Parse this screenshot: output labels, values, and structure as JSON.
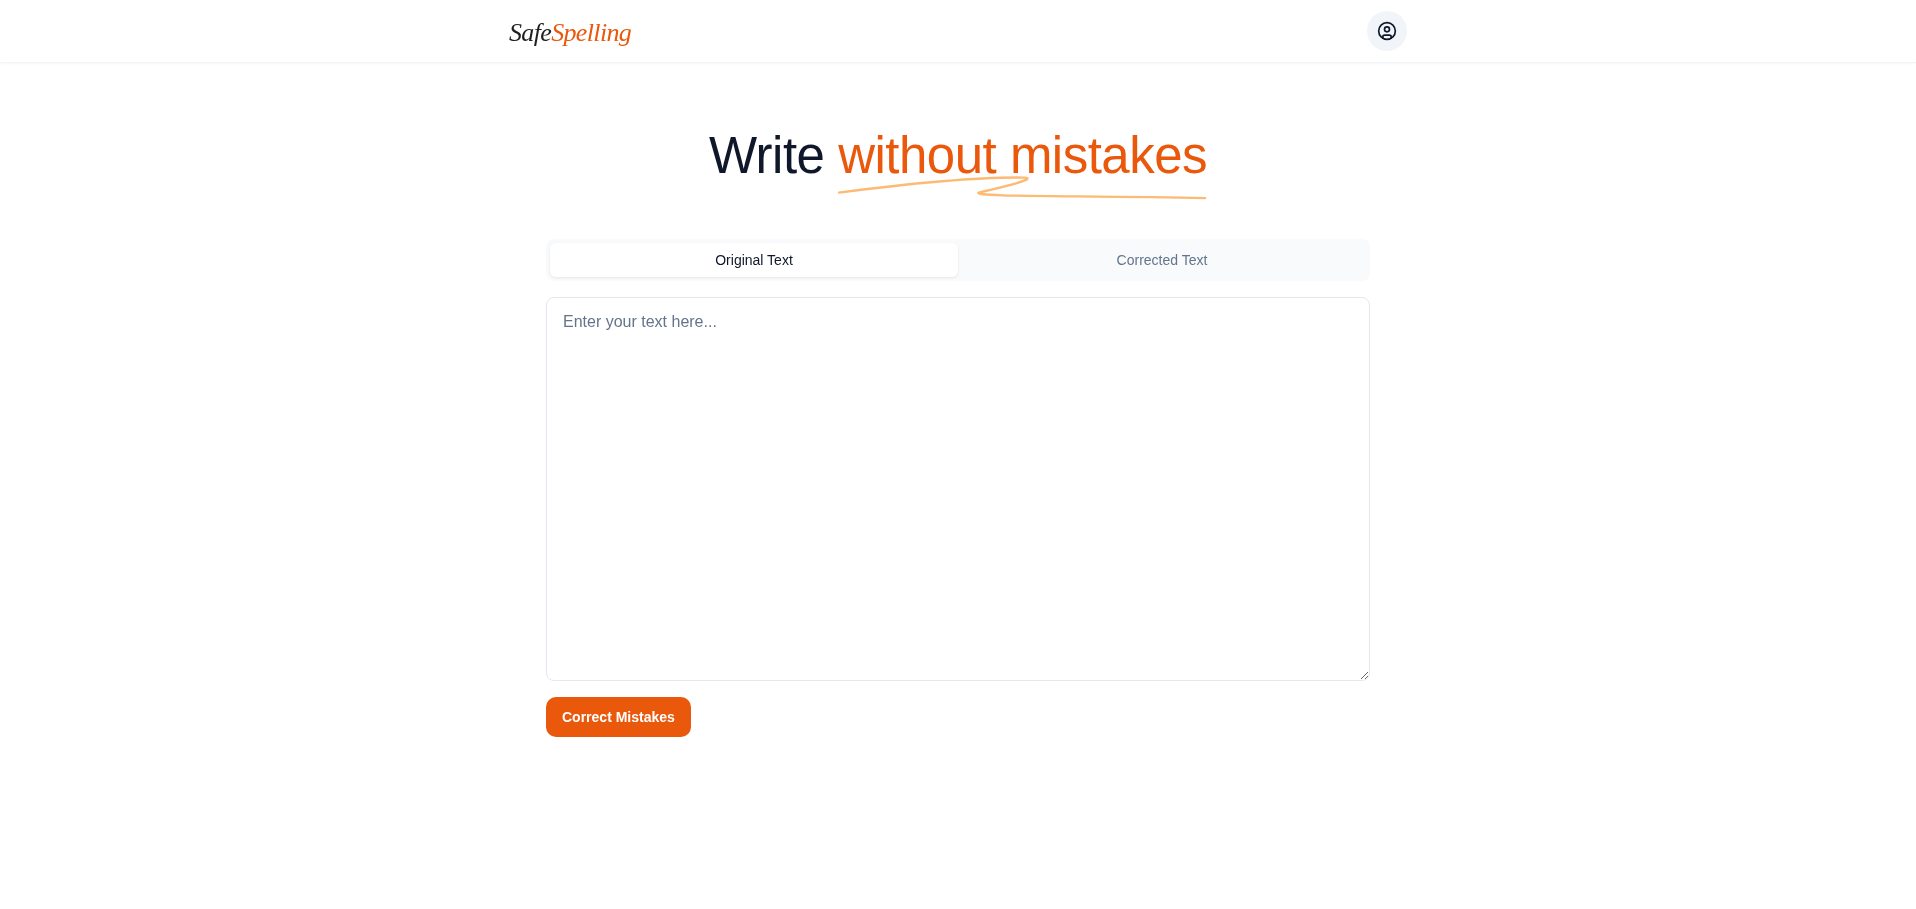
{
  "header": {
    "logo": {
      "first": "Safe",
      "second": "Spelling"
    }
  },
  "heading": {
    "text": "Write",
    "highlight": "without mistakes"
  },
  "tabs": [
    {
      "label": "Original Text",
      "selected": true
    },
    {
      "label": "Corrected Text",
      "selected": false
    }
  ],
  "editor": {
    "placeholder": "Enter your text here..."
  },
  "submit_button": {
    "label": "Correct Mistakes"
  }
}
